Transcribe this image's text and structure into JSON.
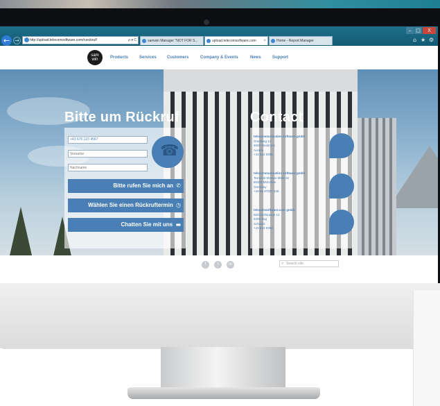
{
  "browser": {
    "address": "http://upload.telecomsoftware.com/rueckruf/",
    "address_tools": "ρ ▾ C",
    "tabs": [
      {
        "label": "samwin Manager \"NOT FOR S..."
      },
      {
        "label": "upload.telecomsoftware.com"
      },
      {
        "label": "Home - Report Manager"
      }
    ],
    "window_buttons": {
      "minimize": "–",
      "maximize": "□",
      "close": "X"
    },
    "tools": {
      "home": "⌂",
      "favorites": "★",
      "settings": "⚙"
    }
  },
  "site": {
    "logo_line1": "sam",
    "logo_line2": "win",
    "nav": [
      "Products",
      "Services",
      "Customers",
      "Company & Events",
      "News",
      "Support"
    ]
  },
  "callback": {
    "heading": "Bitte um Rückruf",
    "phone_value": "+43 676 123 4567",
    "firstname_placeholder": "Vorname",
    "lastname_placeholder": "Nachname",
    "buttons": [
      {
        "label": "Bitte rufen Sie mich an",
        "icon": "phone-icon",
        "glyph": "✆"
      },
      {
        "label": "Wählen Sie einen Rückruftermin",
        "icon": "clock-icon",
        "glyph": "◷"
      },
      {
        "label": "Chatten Sie mit uns",
        "icon": "chat-icon",
        "glyph": "▬"
      }
    ],
    "phone_badge_glyph": "☎"
  },
  "contact": {
    "heading": "Contact",
    "offices": [
      {
        "name": "telecommunication software gmbh",
        "lines": [
          "Graslweg 14",
          "6020 Innsbruck",
          "Austria",
          "+43 512 9396"
        ]
      },
      {
        "name": "telecommunication software gmbh",
        "lines": [
          "Terminal Strasse Mitte 18",
          "85356 München",
          "Germany",
          "+49 89 97007 428"
        ]
      },
      {
        "name": "telecomsoftware.com gmbh",
        "lines": [
          "Bahnhofstrasse 12",
          "6300 Zug",
          "Schweiz",
          "+43 512 9396"
        ]
      }
    ]
  },
  "footer": {
    "social": [
      "f",
      "t",
      "in"
    ],
    "search_placeholder": "Search site",
    "search_glyph": "⌕"
  },
  "colors": {
    "accent": "#4a7fb5",
    "browser_chrome": "#1f6f8b",
    "close": "#c9463d"
  }
}
